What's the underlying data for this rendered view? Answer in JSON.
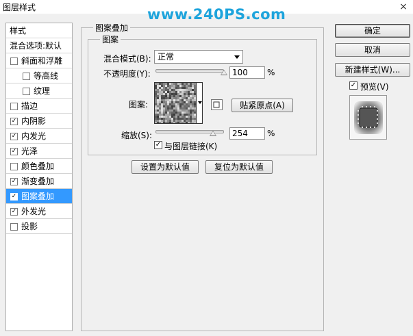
{
  "window": {
    "title": "图层样式",
    "close_icon": "×"
  },
  "watermark": "www.240PS.com",
  "left_panel": {
    "header_styles": "样式",
    "header_blend": "混合选项:默认",
    "items": [
      {
        "label": "斜面和浮雕",
        "checked": false,
        "indent": false
      },
      {
        "label": "等高线",
        "checked": false,
        "indent": true
      },
      {
        "label": "纹理",
        "checked": false,
        "indent": true
      },
      {
        "label": "描边",
        "checked": false,
        "indent": false
      },
      {
        "label": "内阴影",
        "checked": true,
        "indent": false
      },
      {
        "label": "内发光",
        "checked": true,
        "indent": false
      },
      {
        "label": "光泽",
        "checked": true,
        "indent": false
      },
      {
        "label": "颜色叠加",
        "checked": false,
        "indent": false
      },
      {
        "label": "渐变叠加",
        "checked": true,
        "indent": false
      },
      {
        "label": "图案叠加",
        "checked": true,
        "indent": false,
        "selected": true
      },
      {
        "label": "外发光",
        "checked": true,
        "indent": false
      },
      {
        "label": "投影",
        "checked": false,
        "indent": false
      }
    ]
  },
  "main": {
    "group_title": "图案叠加",
    "subgroup_title": "图案",
    "blend_mode_label": "混合模式(B):",
    "blend_mode_value": "正常",
    "opacity_label": "不透明度(Y):",
    "opacity_value": "100",
    "opacity_unit": "%",
    "opacity_level": 1.0,
    "pattern_label": "图案:",
    "snap_origin_button": "贴紧原点(A)",
    "scale_label": "缩放(S):",
    "scale_value": "254",
    "scale_unit": "%",
    "scale_level": 0.25,
    "link_with_layer_label": "与图层链接(K)",
    "link_with_layer_checked": true,
    "make_default_button": "设置为默认值",
    "reset_default_button": "复位为默认值"
  },
  "right_panel": {
    "ok_button": "确定",
    "cancel_button": "取消",
    "new_style_button": "新建样式(W)...",
    "preview_label": "预览(V)",
    "preview_checked": true
  },
  "check_mark": "✓"
}
